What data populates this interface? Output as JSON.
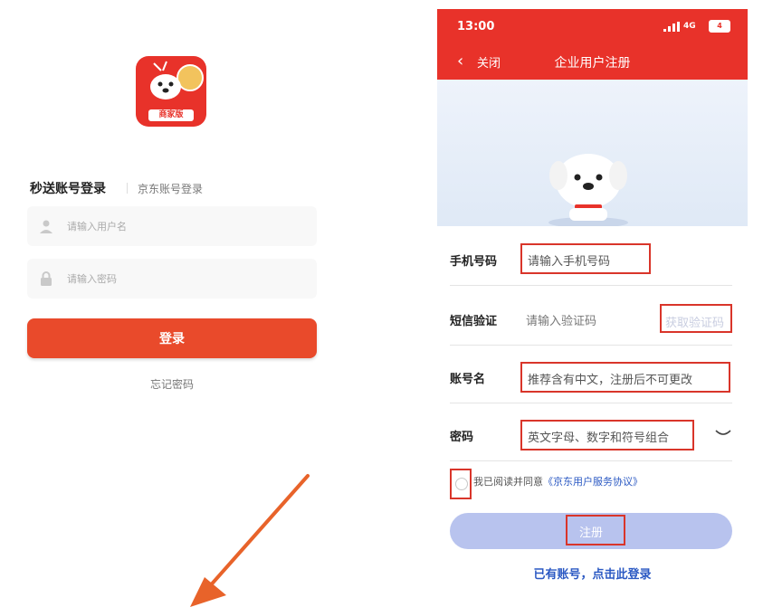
{
  "login": {
    "logo_badge": "商家版",
    "tabs": [
      {
        "label": "秒送账号登录",
        "active": true
      },
      {
        "label": "京东账号登录",
        "active": false
      }
    ],
    "username_placeholder": "请输入用户名",
    "password_placeholder": "请输入密码",
    "login_button": "登录",
    "forgot_password": "忘记密码"
  },
  "register": {
    "status_bar": {
      "time": "13:00",
      "network": "4G",
      "battery": "4"
    },
    "nav": {
      "back_label": "关闭",
      "title": "企业用户注册"
    },
    "fields": {
      "phone": {
        "label": "手机号码",
        "placeholder": "请输入手机号码"
      },
      "sms": {
        "label": "短信验证",
        "placeholder": "请输入验证码",
        "button": "获取验证码"
      },
      "account": {
        "label": "账号名",
        "placeholder": "推荐含有中文，注册后不可更改"
      },
      "password": {
        "label": "密码",
        "placeholder": "英文字母、数字和符号组合"
      }
    },
    "agreement": {
      "text": "我已阅读并同意",
      "link": "《京东用户服务协议》"
    },
    "register_button": "注册",
    "login_link": "已有账号，点击此登录"
  },
  "colors": {
    "brand_red": "#e8322a",
    "highlight_box": "#d9352a",
    "link_blue": "#2b59c3",
    "register_button": "#b8c3ee"
  },
  "icons": [
    "app-logo-icon",
    "user-icon",
    "lock-icon",
    "back-chevron-icon",
    "mascot-dog-icon",
    "eye-closed-icon",
    "checkbox-circle-icon",
    "annotation-arrow-icon"
  ]
}
